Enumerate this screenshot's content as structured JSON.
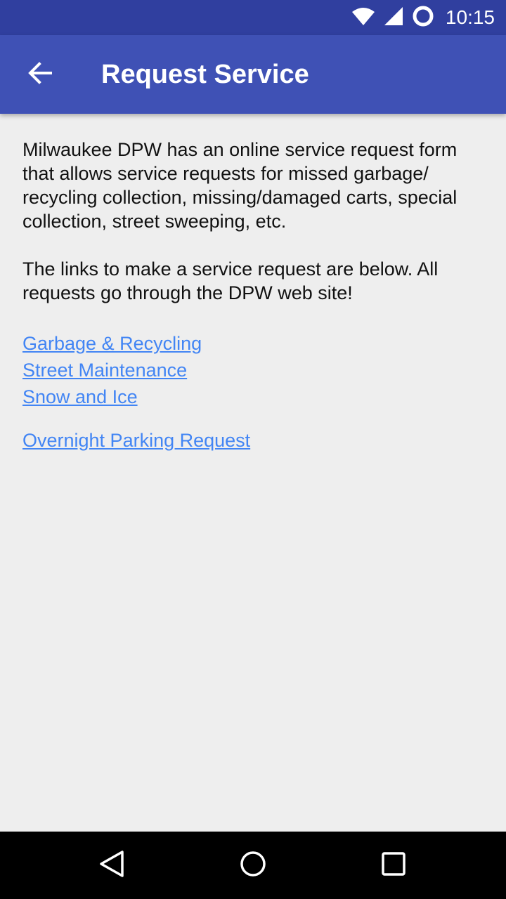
{
  "status_bar": {
    "time": "10:15",
    "icons": [
      "wifi-icon",
      "cell-signal-icon",
      "sync-icon"
    ]
  },
  "app_bar": {
    "title": "Request Service",
    "back_icon": "arrow-back-icon"
  },
  "content": {
    "paragraph_1": "Milwaukee DPW has an online service request form that allows service requests for missed garbage/ recycling collection, missing/damaged carts, special collection, street sweeping, etc.",
    "paragraph_2": "The links to make a service request are below. All requests go through the DPW web site!",
    "links": [
      {
        "label": "Garbage & Recycling"
      },
      {
        "label": "Street Maintenance"
      },
      {
        "label": "Snow and Ice"
      }
    ],
    "overnight_link": "Overnight Parking Request"
  },
  "nav_bar": {
    "icons": [
      "nav-back-icon",
      "nav-home-icon",
      "nav-recents-icon"
    ]
  },
  "colors": {
    "status_bar": "#303f9f",
    "app_bar": "#3f51b5",
    "background": "#eeeeee",
    "link": "#4285f4"
  }
}
